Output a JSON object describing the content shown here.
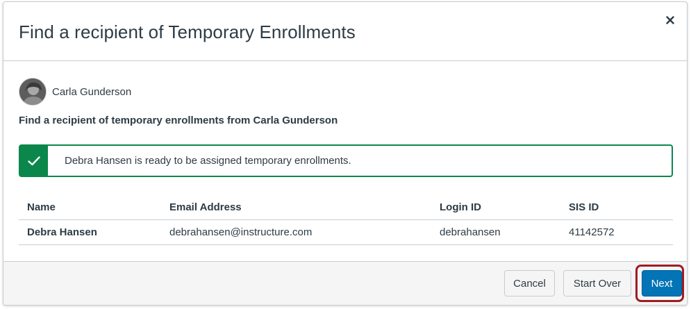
{
  "modal": {
    "title": "Find a recipient of Temporary Enrollments",
    "close_icon": "close-icon"
  },
  "source_user": {
    "name": "Carla Gunderson",
    "avatar_icon": "avatar"
  },
  "subtitle": "Find a recipient of temporary enrollments from Carla Gunderson",
  "alert": {
    "icon": "checkmark-icon",
    "message": "Debra Hansen is ready to be assigned temporary enrollments.",
    "color": "#0b874b"
  },
  "table": {
    "headers": [
      "Name",
      "Email Address",
      "Login ID",
      "SIS ID"
    ],
    "rows": [
      [
        "Debra Hansen",
        "debrahansen@instructure.com",
        "debrahansen",
        "41142572"
      ]
    ]
  },
  "footer": {
    "cancel_label": "Cancel",
    "start_over_label": "Start Over",
    "next_label": "Next",
    "primary_color": "#0374b5",
    "highlight_color": "#9e1c22"
  }
}
